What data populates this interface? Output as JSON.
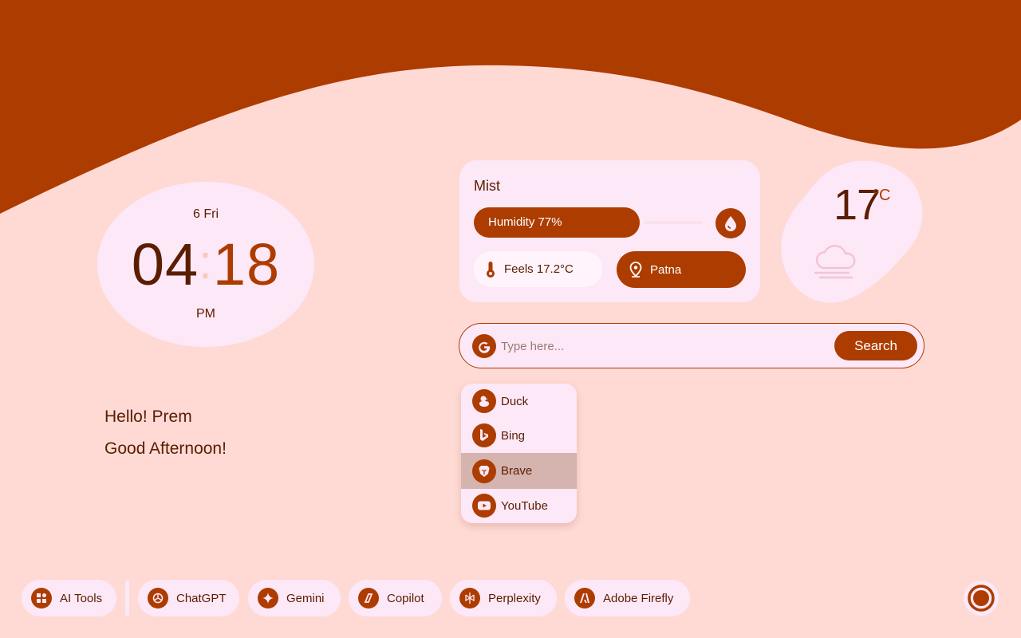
{
  "clock": {
    "day": "6 Fri",
    "hour": "04",
    "separator": ":",
    "minute": "18",
    "ampm": "PM"
  },
  "greeting": {
    "line1": "Hello! Prem",
    "line2": "Good Afternoon!"
  },
  "weather": {
    "condition": "Mist",
    "humidity_label": "Humidity 77%",
    "humidity_percent": 77,
    "feels_label": "Feels 17.2°C",
    "location": "Patna",
    "temperature": "17",
    "unit": "°C"
  },
  "search": {
    "placeholder": "Type here...",
    "button_label": "Search",
    "engine_icon": "google-icon"
  },
  "engines": [
    {
      "label": "Duck",
      "icon": "duck-icon"
    },
    {
      "label": "Bing",
      "icon": "bing-icon"
    },
    {
      "label": "Brave",
      "icon": "brave-icon",
      "selected": true
    },
    {
      "label": "YouTube",
      "icon": "youtube-icon"
    }
  ],
  "shortcuts": [
    {
      "label": "AI Tools",
      "icon": "ai-tools-icon"
    },
    {
      "label": "ChatGPT",
      "icon": "chatgpt-icon"
    },
    {
      "label": "Gemini",
      "icon": "gemini-icon"
    },
    {
      "label": "Copilot",
      "icon": "copilot-icon"
    },
    {
      "label": "Perplexity",
      "icon": "perplexity-icon"
    },
    {
      "label": "Adobe Firefly",
      "icon": "firefly-icon"
    }
  ],
  "colors": {
    "accent": "#ad3c00",
    "background": "#ffdad5",
    "card": "#fde8f7",
    "text": "#5a1d00"
  }
}
